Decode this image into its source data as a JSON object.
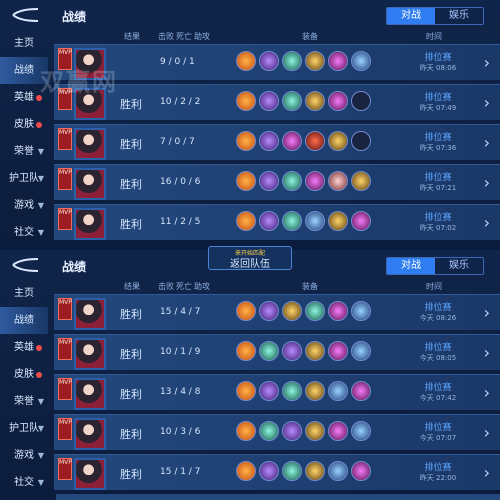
{
  "watermark": "双赢网",
  "panels": [
    {
      "title": "战绩",
      "tabs": [
        "对战",
        "娱乐"
      ],
      "sidebar": [
        "主页",
        "战绩",
        "英雄",
        "皮肤",
        "荣誉",
        "护卫队",
        "游戏",
        "社交"
      ],
      "headers": {
        "result": "结果",
        "kills": "击败",
        "deaths": "死亡",
        "assists": "助攻",
        "items": "装备",
        "time": "时间"
      },
      "rows": [
        {
          "result": "",
          "kda": "9 / 0 / 1",
          "mode": "排位赛",
          "time": "昨天 08:06"
        },
        {
          "result": "胜利",
          "kda": "10 / 2 / 2",
          "mode": "排位赛",
          "time": "昨天 07:49"
        },
        {
          "result": "胜利",
          "kda": "7 / 0 / 7",
          "mode": "排位赛",
          "time": "昨天 07:36"
        },
        {
          "result": "胜利",
          "kda": "16 / 0 / 6",
          "mode": "排位赛",
          "time": "昨天 07:21"
        },
        {
          "result": "胜利",
          "kda": "11 / 2 / 5",
          "mode": "排位赛",
          "time": "昨天 07:02"
        }
      ]
    },
    {
      "title": "战绩",
      "tabs": [
        "对战",
        "娱乐"
      ],
      "sidebar": [
        "主页",
        "战绩",
        "英雄",
        "皮肤",
        "荣誉",
        "护卫队",
        "游戏",
        "社交"
      ],
      "headers": {
        "result": "结果",
        "kills": "击败",
        "deaths": "死亡",
        "assists": "助攻",
        "items": "装备",
        "time": "时间"
      },
      "rows": [
        {
          "result": "胜利",
          "kda": "15 / 4 / 7",
          "mode": "排位赛",
          "time": "今天 08:26"
        },
        {
          "result": "胜利",
          "kda": "10 / 1 / 9",
          "mode": "排位赛",
          "time": "今天 08:05"
        },
        {
          "result": "胜利",
          "kda": "13 / 4 / 8",
          "mode": "排位赛",
          "time": "今天 07:42"
        },
        {
          "result": "胜利",
          "kda": "10 / 3 / 6",
          "mode": "排位赛",
          "time": "今天 07:07"
        },
        {
          "result": "胜利",
          "kda": "15 / 1 / 7",
          "mode": "排位赛",
          "time": "昨天 22:00"
        }
      ]
    }
  ],
  "return_button": {
    "sub": "来开始匹配",
    "label": "返回队伍"
  },
  "ui": {
    "mvp": "MVP",
    "chevron": "›"
  },
  "colors": {
    "panel_bg": "#10254a",
    "row_bg": "#24487d",
    "accent": "#2f7df0"
  }
}
